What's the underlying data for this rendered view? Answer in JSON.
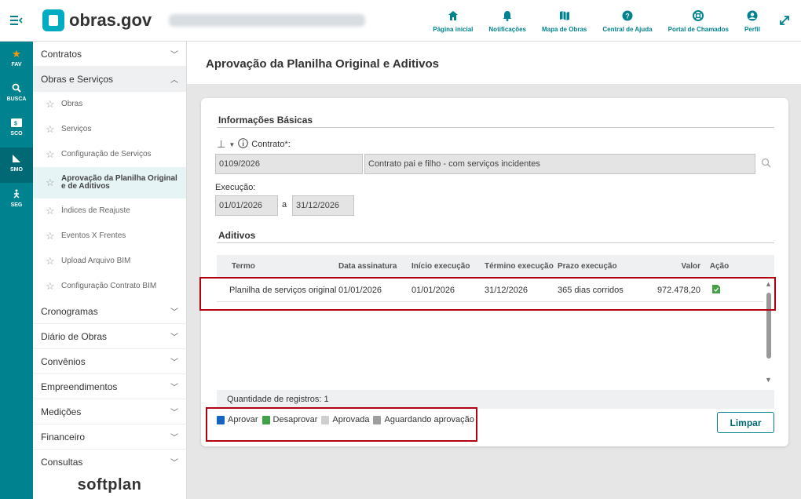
{
  "header": {
    "logo_text": "obras.gov",
    "nav": [
      {
        "label": "Página inicial",
        "icon": "home-icon"
      },
      {
        "label": "Notificações",
        "icon": "bell-icon"
      },
      {
        "label": "Mapa de Obras",
        "icon": "map-icon"
      },
      {
        "label": "Central de Ajuda",
        "icon": "help-icon"
      },
      {
        "label": "Portal de Chamados",
        "icon": "lifebuoy-icon"
      },
      {
        "label": "Perfil",
        "icon": "user-icon"
      }
    ]
  },
  "rail": [
    {
      "label": "FAV",
      "icon": "star-icon"
    },
    {
      "label": "BUSCA",
      "icon": "search-icon"
    },
    {
      "label": "SCO",
      "icon": "sco-icon"
    },
    {
      "label": "SMO",
      "icon": "smo-icon"
    },
    {
      "label": "SEG",
      "icon": "seg-icon"
    }
  ],
  "sidebar": {
    "groups_top": [
      {
        "label": "Contratos"
      },
      {
        "label": "Obras e Serviços"
      }
    ],
    "items": [
      {
        "label": "Obras"
      },
      {
        "label": "Serviços"
      },
      {
        "label": "Configuração de Serviços"
      },
      {
        "label": "Aprovação da Planilha Original e de Aditivos"
      },
      {
        "label": "Índices de Reajuste"
      },
      {
        "label": "Eventos X Frentes"
      },
      {
        "label": "Upload Arquivo BIM"
      },
      {
        "label": "Configuração Contrato BIM"
      }
    ],
    "groups_bottom": [
      {
        "label": "Cronogramas"
      },
      {
        "label": "Diário de Obras"
      },
      {
        "label": "Convênios"
      },
      {
        "label": "Empreendimentos"
      },
      {
        "label": "Medições"
      },
      {
        "label": "Financeiro"
      },
      {
        "label": "Consultas"
      }
    ],
    "brand": "softplan"
  },
  "page": {
    "title": "Aprovação da Planilha Original e Aditivos"
  },
  "basic": {
    "section_title": "Informações Básicas",
    "contract_label": "Contrato*:",
    "contract_number": "0109/2026",
    "contract_description": "Contrato pai e filho - com serviços incidentes",
    "execution_label": "Execução:",
    "execution_start": "01/01/2026",
    "execution_sep": "a",
    "execution_end": "31/12/2026"
  },
  "aditivos": {
    "section_title": "Aditivos",
    "columns": [
      "Termo",
      "Data assinatura",
      "Início execução",
      "Término execução",
      "Prazo execução",
      "Valor",
      "Ação"
    ],
    "rows": [
      {
        "termo": "Planilha de serviços original",
        "data_assinatura": "01/01/2026",
        "inicio": "01/01/2026",
        "termino": "31/12/2026",
        "prazo": "365 dias corridos",
        "valor": "972.478,20"
      }
    ],
    "record_count": "Quantidade de registros: 1"
  },
  "legend": [
    {
      "label": "Aprovar",
      "color": "#1565c0"
    },
    {
      "label": "Desaprovar",
      "color": "#43a047"
    },
    {
      "label": "Aprovada",
      "color": "#cfcfcf"
    },
    {
      "label": "Aguardando aprovação",
      "color": "#9e9e9e"
    }
  ],
  "actions": {
    "clear_label": "Limpar"
  },
  "colors": {
    "brand": "#00838f",
    "highlight": "#b00012"
  }
}
